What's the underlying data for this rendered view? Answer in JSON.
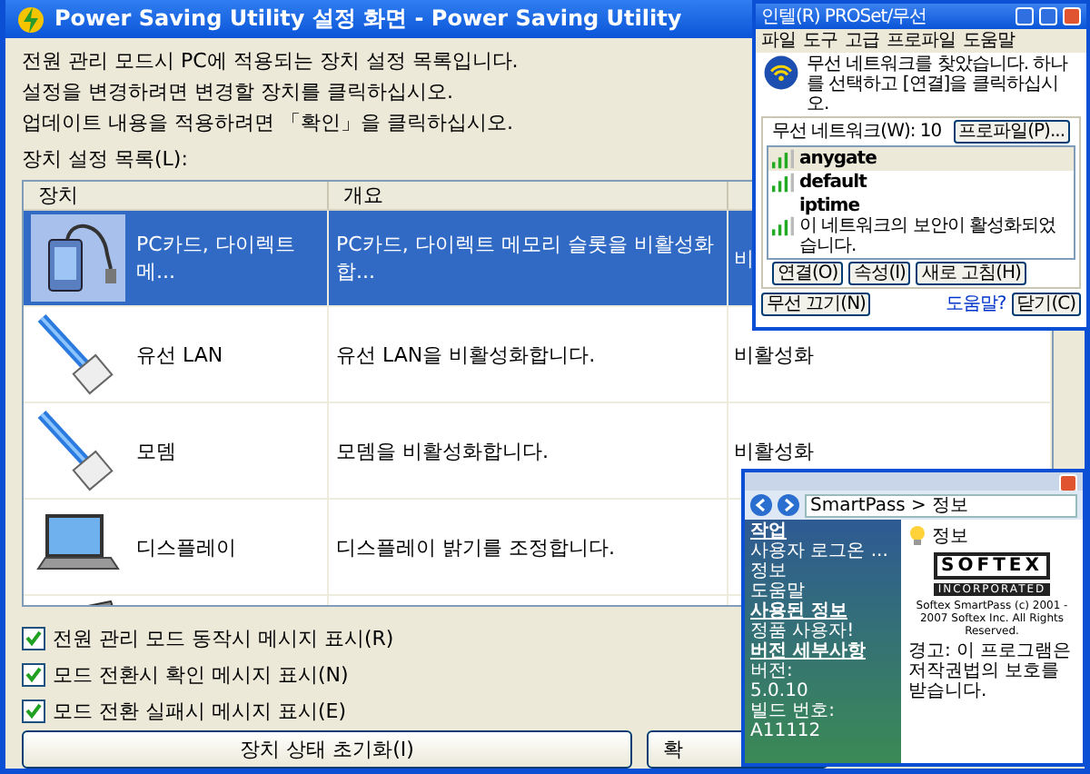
{
  "window": {
    "title": "Power Saving Utility 설정 화면 - Power Saving Utility"
  },
  "intro": [
    "전원 관리 모드시 PC에 적용되는 장치 설정 목록입니다.",
    "설정을 변경하려면 변경할 장치를 클릭하십시오.",
    "업데이트 내용을 적용하려면 「확인」을 클릭하십시오."
  ],
  "list_label": "장치 설정 목록(L):",
  "table": {
    "columns": [
      "장치",
      "개요"
    ],
    "rows": [
      {
        "kind": "card",
        "device": "PC카드, 다이렉트 메...",
        "summary": "PC카드, 다이렉트 메모리 슬롯을 비활성화합...",
        "column_3": "비",
        "selected": true
      },
      {
        "kind": "cable",
        "device": "유선 LAN",
        "summary": "유선 LAN을 비활성화합니다.",
        "column_3": "비활성화",
        "selected": false
      },
      {
        "kind": "cable",
        "device": "모뎀",
        "summary": "모뎀을 비활성화합니다.",
        "column_3": "비활성화",
        "selected": false
      },
      {
        "kind": "laptop",
        "device": "디스플레이",
        "summary": "디스플레이 밝기를 조정합니다.",
        "selected": false
      },
      {
        "kind": "keyboard",
        "selected": false
      }
    ]
  },
  "options": [
    {
      "label": "전원 관리 모드 동작시 메시지 표시(R)",
      "checked": true
    },
    {
      "label": "모드 전환시 확인 메시지 표시(N)",
      "checked": true
    },
    {
      "label": "모드 전환 실패시 메시지 표시(E)",
      "checked": true
    }
  ],
  "buttons": [
    "장치 상태 초기화(I)",
    "확"
  ],
  "wireless_window": {
    "title": "인텔(R) PROSet/무선",
    "menu": [
      "파일",
      "도구",
      "고급",
      "프로파일",
      "도움말"
    ],
    "message": "무선 네트워크를 찾았습니다. 하나를 선택하고 [연결]을 클릭하십시오.",
    "group_label": "무선 네트워크(W): 10",
    "networks": [
      {
        "name": "anygate",
        "selected": true
      },
      {
        "name": "default",
        "selected": false
      },
      {
        "name": "iptime",
        "note": "이 네트워크의 보안이 활성화되었습니다.",
        "selected": false
      }
    ],
    "buttons": [
      "연결(O)",
      "속성(I)",
      "새로 고침(H)"
    ],
    "profiles_button": "프로파일(P)...",
    "dropdown": "무선 끄기(N)",
    "help_link": "도움말?",
    "close_button": "닫기(C)"
  },
  "about_window": {
    "breadcrumb": "SmartPass > 정보",
    "sidebar": [
      {
        "heading": "작업",
        "items": [
          "사용자 로그온 ...",
          "정보",
          "도움말"
        ]
      },
      {
        "heading": "사용된 정보",
        "items": [
          "정품 사용자!"
        ]
      },
      {
        "heading": "버전 세부사항",
        "items": [
          "버전:",
          "5.0.10",
          "빌드 번호:",
          "A11112"
        ]
      }
    ],
    "heading": "정보",
    "logo": "SOFTEX",
    "logo_sub": "INCORPORATED",
    "copyright": "Softex SmartPass (c) 2001 - 2007 Softex Inc. All Rights Reserved.",
    "notice": "경고: 이 프로그램은 저작권법의 보호를 받습니다."
  }
}
